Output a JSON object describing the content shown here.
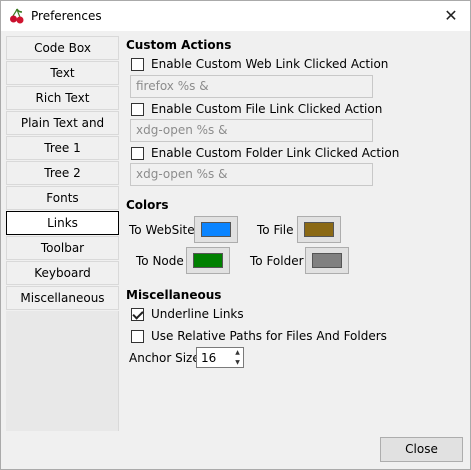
{
  "window": {
    "title": "Preferences"
  },
  "sidebar": {
    "items": [
      {
        "label": "Code Box"
      },
      {
        "label": "Text"
      },
      {
        "label": "Rich Text"
      },
      {
        "label": "Plain Text and Code"
      },
      {
        "label": "Tree 1"
      },
      {
        "label": "Tree 2"
      },
      {
        "label": "Fonts"
      },
      {
        "label": "Links"
      },
      {
        "label": "Toolbar"
      },
      {
        "label": "Keyboard Shortcuts"
      },
      {
        "label": "Miscellaneous"
      }
    ],
    "selected": "Links"
  },
  "custom_actions": {
    "heading": "Custom Actions",
    "web_link": {
      "label": "Enable Custom Web Link Clicked Action",
      "checked": false,
      "value": "firefox %s &"
    },
    "file_link": {
      "label": "Enable Custom File Link Clicked Action",
      "checked": false,
      "value": "xdg-open %s &"
    },
    "folder_link": {
      "label": "Enable Custom Folder Link Clicked Action",
      "checked": false,
      "value": "xdg-open %s &"
    }
  },
  "colors": {
    "heading": "Colors",
    "to_website": {
      "label": "To WebSite",
      "color": "#0a84ff"
    },
    "to_file": {
      "label": "To File",
      "color": "#8b6914"
    },
    "to_node": {
      "label": "To Node",
      "color": "#008000"
    },
    "to_folder": {
      "label": "To Folder",
      "color": "#808080"
    }
  },
  "misc": {
    "heading": "Miscellaneous",
    "underline": {
      "label": "Underline Links",
      "checked": true
    },
    "relative_paths": {
      "label": "Use Relative Paths for Files And Folders",
      "checked": false
    },
    "anchor_size": {
      "label": "Anchor Size",
      "value": "16"
    }
  },
  "footer": {
    "close_label": "Close"
  }
}
